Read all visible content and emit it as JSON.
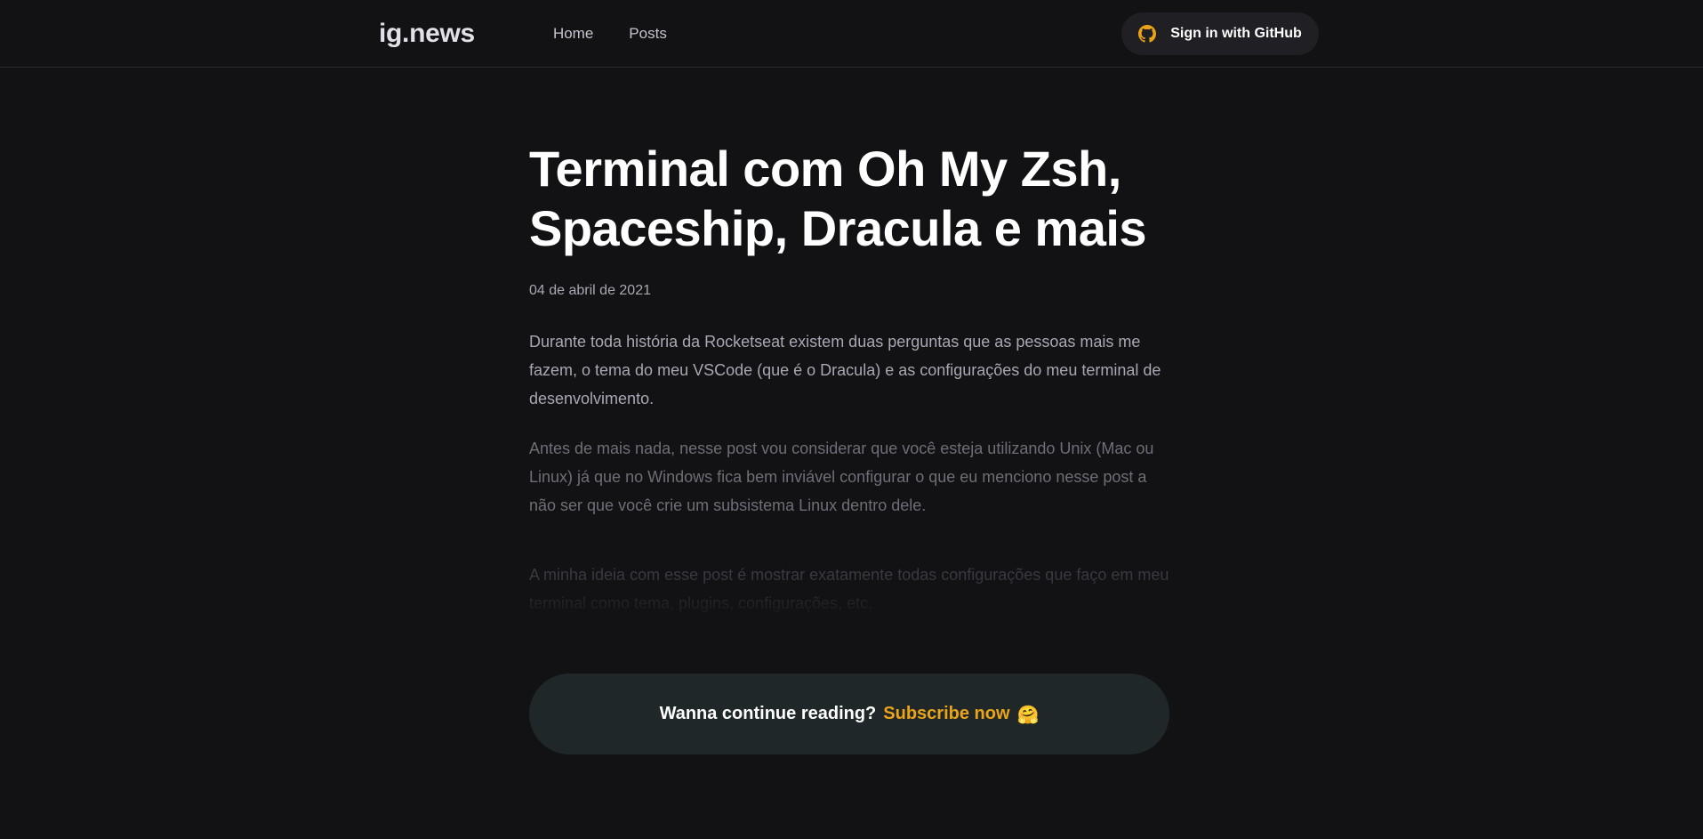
{
  "header": {
    "logo": "ig.news",
    "nav": [
      {
        "label": "Home"
      },
      {
        "label": "Posts"
      }
    ],
    "signin_label": "Sign in with GitHub",
    "signin_icon": "github-icon"
  },
  "post": {
    "title": "Terminal com Oh My Zsh, Spaceship, Dracula e mais",
    "date": "04 de abril de 2021",
    "paragraphs": [
      "Durante toda história da Rocketseat existem duas perguntas que as pessoas mais me fazem, o tema do meu VSCode (que é o Dracula) e as configurações do meu terminal de desenvolvimento.",
      "Antes de mais nada, nesse post vou considerar que você esteja utilizando Unix (Mac ou Linux) já que no Windows fica bem inviável configurar o que eu menciono nesse post a não ser que você crie um subsistema Linux dentro dele.",
      "A minha ideia com esse post é mostrar exatamente todas configurações que faço em meu terminal como tema, plugins, configurações, etc."
    ]
  },
  "subscribe": {
    "prompt": "Wanna continue reading?",
    "link": "Subscribe now",
    "emoji": "🤗"
  },
  "colors": {
    "background": "#121214",
    "accent": "#eba417",
    "button_bg": "#202024",
    "subscribe_bg": "#1f2729"
  }
}
